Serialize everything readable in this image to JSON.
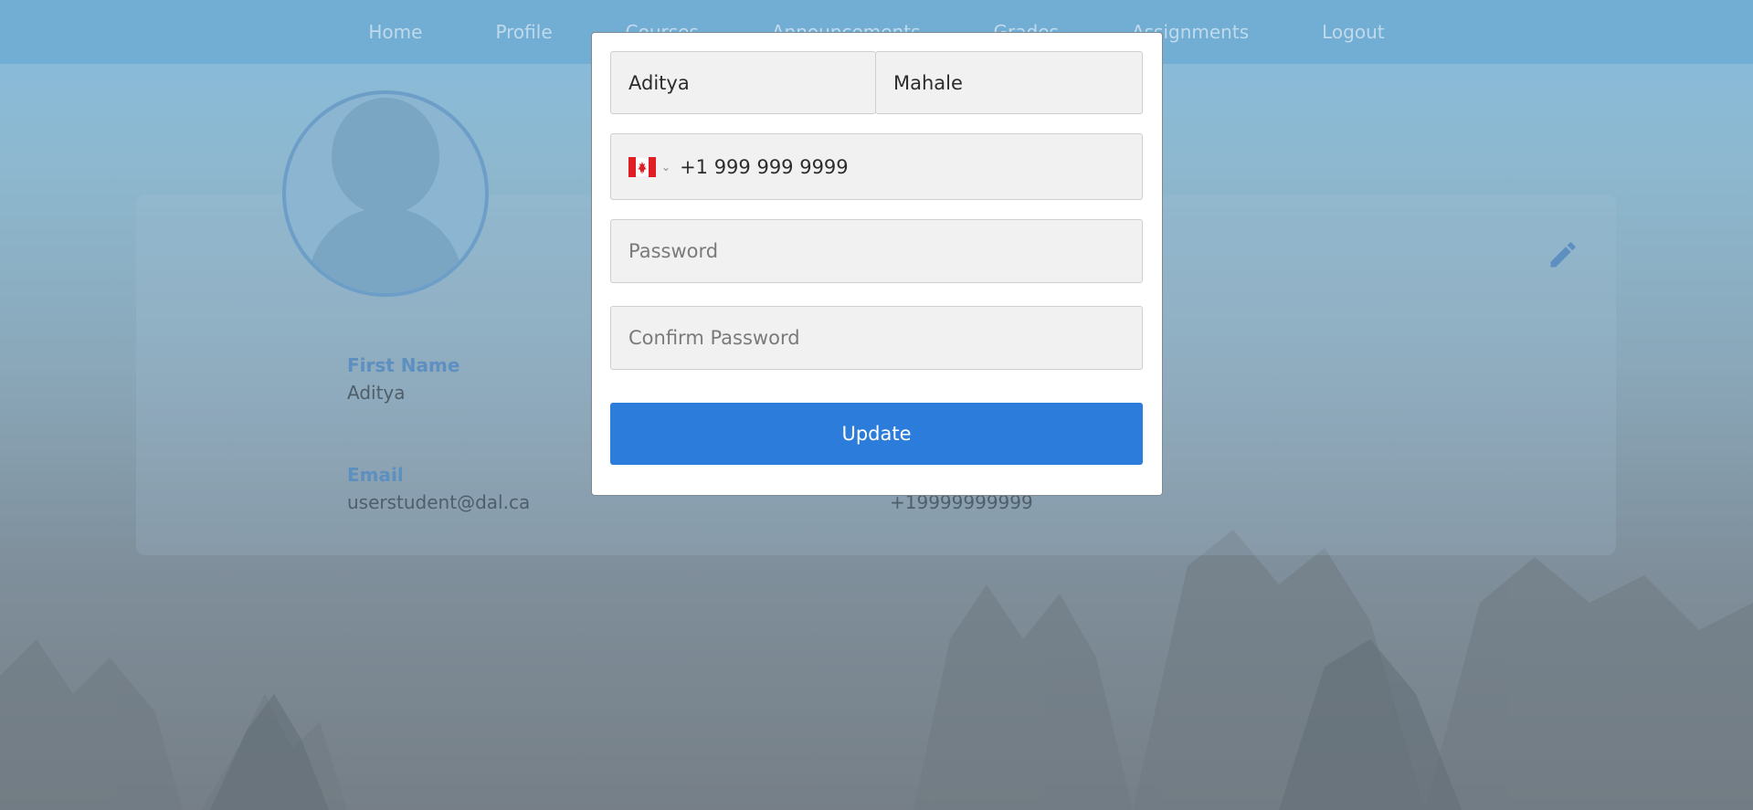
{
  "nav": {
    "items": [
      "Home",
      "Profile",
      "Courses",
      "Announcements",
      "Grades",
      "Assignments",
      "Logout"
    ]
  },
  "profile": {
    "first_name_label": "First Name",
    "first_name_value": "Aditya",
    "email_label": "Email",
    "email_value": "userstudent@dal.ca",
    "phone_value": "+19999999999"
  },
  "modal": {
    "first_name": "Aditya",
    "last_name": "Mahale",
    "phone": "+1 999 999 9999",
    "password_placeholder": "Password",
    "confirm_password_placeholder": "Confirm Password",
    "update_label": "Update"
  },
  "colors": {
    "accent": "#2c7ddb",
    "label_blue": "#5d8fc0"
  }
}
